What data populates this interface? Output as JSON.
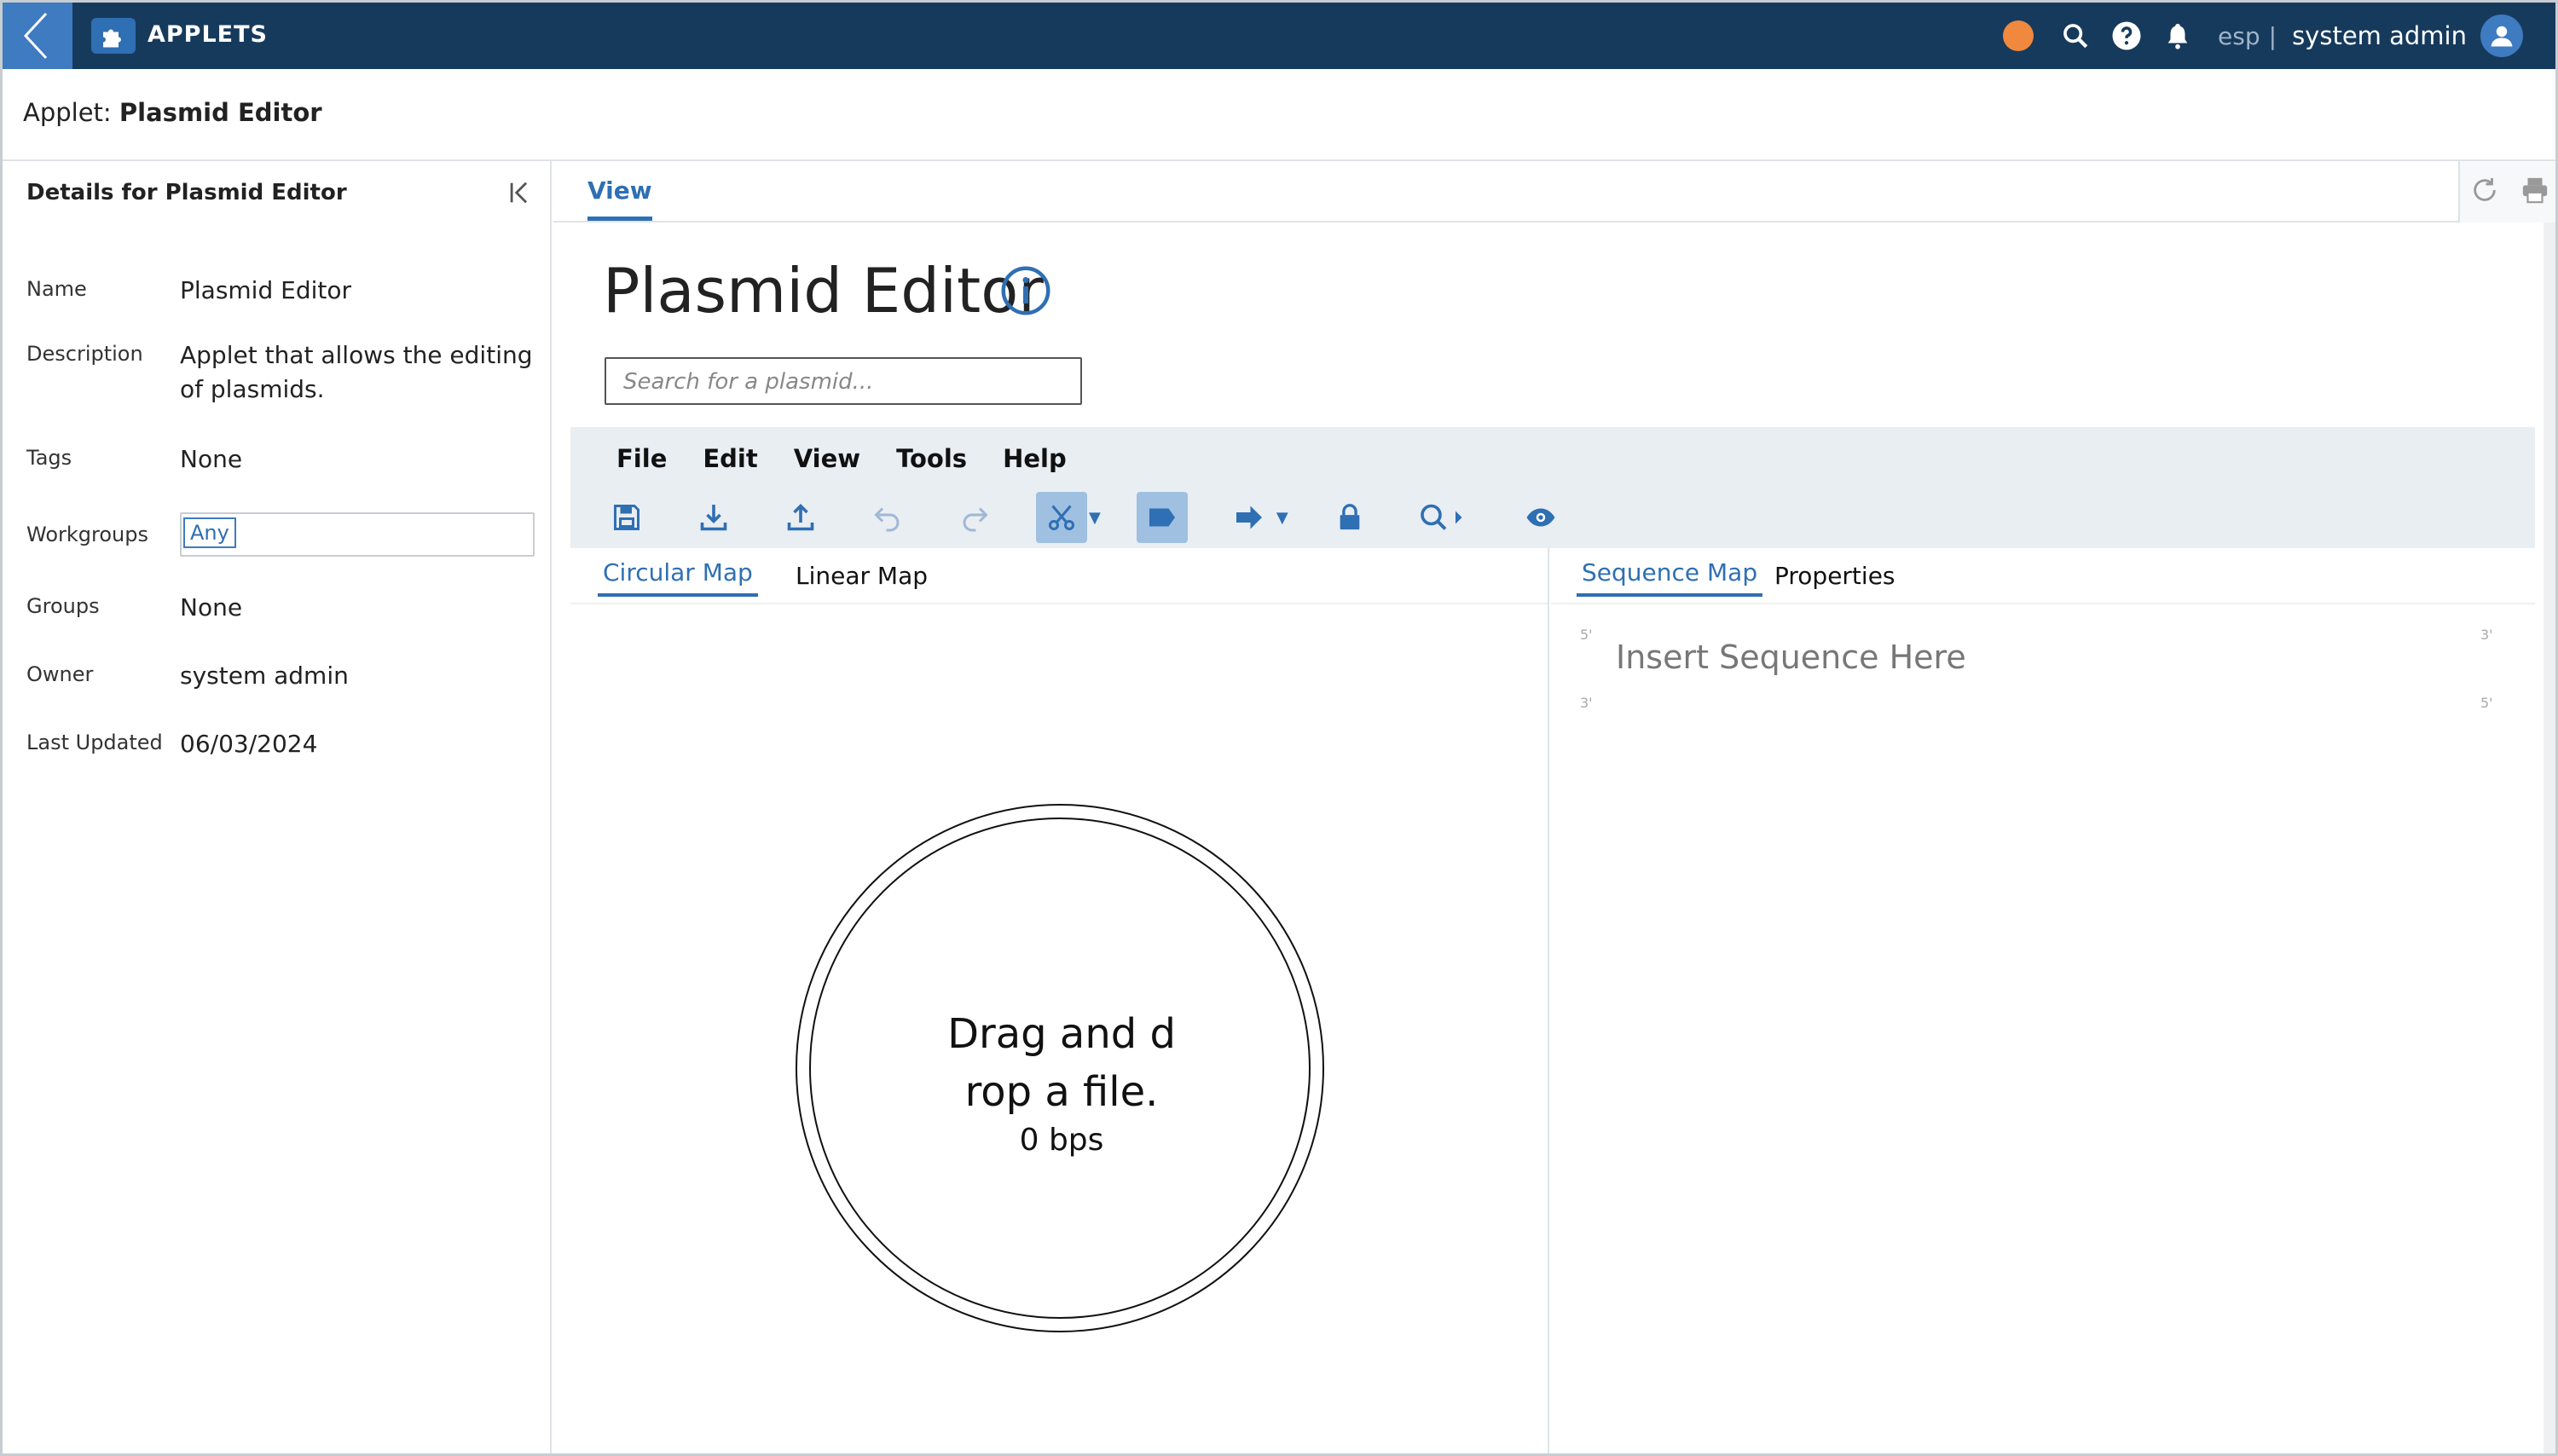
{
  "topbar": {
    "app_title": "APPLETS",
    "lang": "esp",
    "separator": "|",
    "user": "system admin"
  },
  "breadcrumb": {
    "prefix": "Applet:",
    "name": "Plasmid Editor"
  },
  "details": {
    "heading": "Details for Plasmid Editor",
    "fields": {
      "name_label": "Name",
      "name_value": "Plasmid Editor",
      "description_label": "Description",
      "description_value": "Applet that allows the editing of plasmids.",
      "tags_label": "Tags",
      "tags_value": "None",
      "workgroups_label": "Workgroups",
      "workgroups_value": "Any",
      "groups_label": "Groups",
      "groups_value": "None",
      "owner_label": "Owner",
      "owner_value": "system admin",
      "updated_label": "Last Updated",
      "updated_value": "06/03/2024"
    }
  },
  "main": {
    "tab": "View",
    "title": "Plasmid Editor",
    "search_placeholder": "Search for a plasmid..."
  },
  "editor": {
    "menu": [
      "File",
      "Edit",
      "View",
      "Tools",
      "Help"
    ],
    "left_tabs": {
      "circular": "Circular Map",
      "linear": "Linear Map"
    },
    "right_tabs": {
      "sequence": "Sequence Map",
      "properties": "Properties"
    },
    "circle_text": "Drag and d\nrop a file.",
    "circle_bps": "0 bps",
    "sequence_placeholder": "Insert Sequence Here",
    "strand_labels": {
      "tl": "5'",
      "tr": "3'",
      "bl": "3'",
      "br": "5'"
    }
  },
  "colors": {
    "topbar": "#163a5c",
    "accent": "#2f6fb3",
    "status_dot": "#f0883e"
  }
}
